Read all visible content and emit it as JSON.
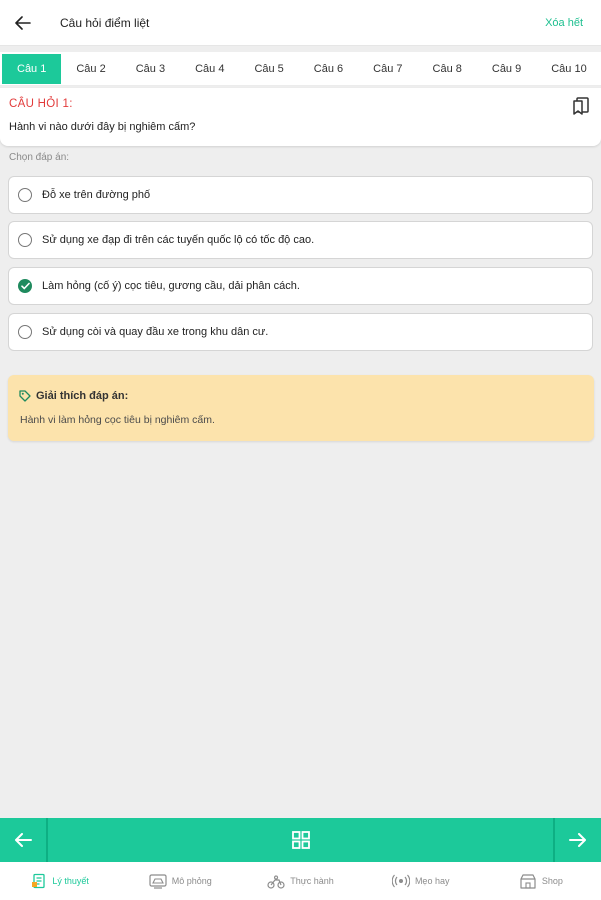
{
  "header": {
    "title": "Câu hỏi điểm liệt",
    "clear_label": "Xóa hết"
  },
  "tabs": [
    "Câu 1",
    "Câu 2",
    "Câu 3",
    "Câu 4",
    "Câu 5",
    "Câu 6",
    "Câu 7",
    "Câu 8",
    "Câu 9",
    "Câu 10"
  ],
  "question": {
    "number_label": "CÂU HỎI 1:",
    "text": "Hành vi nào dưới đây bị nghiêm cấm?"
  },
  "choose_label": "Chọn đáp án:",
  "options": [
    {
      "text": "Đỗ xe trên đường phố",
      "selected": false
    },
    {
      "text": "Sử dụng xe đạp đi trên các tuyến quốc lộ có tốc độ cao.",
      "selected": false
    },
    {
      "text": "Làm hỏng (cố ý) cọc tiêu, gương cầu, dải phân cách.",
      "selected": true
    },
    {
      "text": "Sử dụng còi và quay đầu xe trong khu dân cư.",
      "selected": false
    }
  ],
  "explanation": {
    "title": "Giải thích đáp án:",
    "text": "Hành vi làm hỏng cọc tiêu bị nghiêm cấm."
  },
  "bottom_tabs": [
    {
      "label": "Lý thuyết",
      "icon": "book-icon",
      "active": true
    },
    {
      "label": "Mô phỏng",
      "icon": "car-sim-icon",
      "active": false
    },
    {
      "label": "Thực hành",
      "icon": "motorbike-icon",
      "active": false
    },
    {
      "label": "Mẹo hay",
      "icon": "broadcast-icon",
      "active": false
    },
    {
      "label": "Shop",
      "icon": "shop-icon",
      "active": false
    }
  ],
  "colors": {
    "accent": "#1cc99a",
    "question_number": "#e23b3b",
    "selected_radio": "#1f8a5e",
    "explanation_bg": "#fce3ac"
  }
}
